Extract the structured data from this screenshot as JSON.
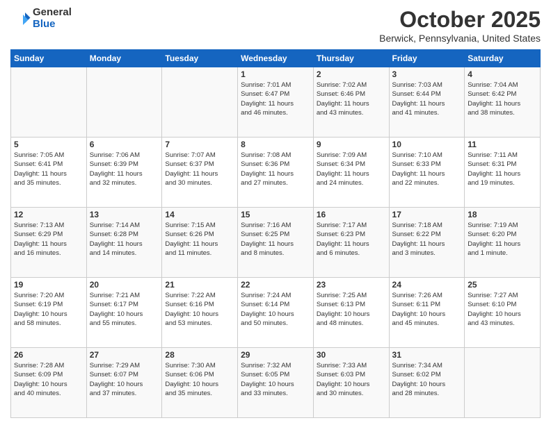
{
  "header": {
    "logo_general": "General",
    "logo_blue": "Blue",
    "month_title": "October 2025",
    "location": "Berwick, Pennsylvania, United States"
  },
  "days_of_week": [
    "Sunday",
    "Monday",
    "Tuesday",
    "Wednesday",
    "Thursday",
    "Friday",
    "Saturday"
  ],
  "weeks": [
    [
      {
        "day": "",
        "info": ""
      },
      {
        "day": "",
        "info": ""
      },
      {
        "day": "",
        "info": ""
      },
      {
        "day": "1",
        "info": "Sunrise: 7:01 AM\nSunset: 6:47 PM\nDaylight: 11 hours\nand 46 minutes."
      },
      {
        "day": "2",
        "info": "Sunrise: 7:02 AM\nSunset: 6:46 PM\nDaylight: 11 hours\nand 43 minutes."
      },
      {
        "day": "3",
        "info": "Sunrise: 7:03 AM\nSunset: 6:44 PM\nDaylight: 11 hours\nand 41 minutes."
      },
      {
        "day": "4",
        "info": "Sunrise: 7:04 AM\nSunset: 6:42 PM\nDaylight: 11 hours\nand 38 minutes."
      }
    ],
    [
      {
        "day": "5",
        "info": "Sunrise: 7:05 AM\nSunset: 6:41 PM\nDaylight: 11 hours\nand 35 minutes."
      },
      {
        "day": "6",
        "info": "Sunrise: 7:06 AM\nSunset: 6:39 PM\nDaylight: 11 hours\nand 32 minutes."
      },
      {
        "day": "7",
        "info": "Sunrise: 7:07 AM\nSunset: 6:37 PM\nDaylight: 11 hours\nand 30 minutes."
      },
      {
        "day": "8",
        "info": "Sunrise: 7:08 AM\nSunset: 6:36 PM\nDaylight: 11 hours\nand 27 minutes."
      },
      {
        "day": "9",
        "info": "Sunrise: 7:09 AM\nSunset: 6:34 PM\nDaylight: 11 hours\nand 24 minutes."
      },
      {
        "day": "10",
        "info": "Sunrise: 7:10 AM\nSunset: 6:33 PM\nDaylight: 11 hours\nand 22 minutes."
      },
      {
        "day": "11",
        "info": "Sunrise: 7:11 AM\nSunset: 6:31 PM\nDaylight: 11 hours\nand 19 minutes."
      }
    ],
    [
      {
        "day": "12",
        "info": "Sunrise: 7:13 AM\nSunset: 6:29 PM\nDaylight: 11 hours\nand 16 minutes."
      },
      {
        "day": "13",
        "info": "Sunrise: 7:14 AM\nSunset: 6:28 PM\nDaylight: 11 hours\nand 14 minutes."
      },
      {
        "day": "14",
        "info": "Sunrise: 7:15 AM\nSunset: 6:26 PM\nDaylight: 11 hours\nand 11 minutes."
      },
      {
        "day": "15",
        "info": "Sunrise: 7:16 AM\nSunset: 6:25 PM\nDaylight: 11 hours\nand 8 minutes."
      },
      {
        "day": "16",
        "info": "Sunrise: 7:17 AM\nSunset: 6:23 PM\nDaylight: 11 hours\nand 6 minutes."
      },
      {
        "day": "17",
        "info": "Sunrise: 7:18 AM\nSunset: 6:22 PM\nDaylight: 11 hours\nand 3 minutes."
      },
      {
        "day": "18",
        "info": "Sunrise: 7:19 AM\nSunset: 6:20 PM\nDaylight: 11 hours\nand 1 minute."
      }
    ],
    [
      {
        "day": "19",
        "info": "Sunrise: 7:20 AM\nSunset: 6:19 PM\nDaylight: 10 hours\nand 58 minutes."
      },
      {
        "day": "20",
        "info": "Sunrise: 7:21 AM\nSunset: 6:17 PM\nDaylight: 10 hours\nand 55 minutes."
      },
      {
        "day": "21",
        "info": "Sunrise: 7:22 AM\nSunset: 6:16 PM\nDaylight: 10 hours\nand 53 minutes."
      },
      {
        "day": "22",
        "info": "Sunrise: 7:24 AM\nSunset: 6:14 PM\nDaylight: 10 hours\nand 50 minutes."
      },
      {
        "day": "23",
        "info": "Sunrise: 7:25 AM\nSunset: 6:13 PM\nDaylight: 10 hours\nand 48 minutes."
      },
      {
        "day": "24",
        "info": "Sunrise: 7:26 AM\nSunset: 6:11 PM\nDaylight: 10 hours\nand 45 minutes."
      },
      {
        "day": "25",
        "info": "Sunrise: 7:27 AM\nSunset: 6:10 PM\nDaylight: 10 hours\nand 43 minutes."
      }
    ],
    [
      {
        "day": "26",
        "info": "Sunrise: 7:28 AM\nSunset: 6:09 PM\nDaylight: 10 hours\nand 40 minutes."
      },
      {
        "day": "27",
        "info": "Sunrise: 7:29 AM\nSunset: 6:07 PM\nDaylight: 10 hours\nand 37 minutes."
      },
      {
        "day": "28",
        "info": "Sunrise: 7:30 AM\nSunset: 6:06 PM\nDaylight: 10 hours\nand 35 minutes."
      },
      {
        "day": "29",
        "info": "Sunrise: 7:32 AM\nSunset: 6:05 PM\nDaylight: 10 hours\nand 33 minutes."
      },
      {
        "day": "30",
        "info": "Sunrise: 7:33 AM\nSunset: 6:03 PM\nDaylight: 10 hours\nand 30 minutes."
      },
      {
        "day": "31",
        "info": "Sunrise: 7:34 AM\nSunset: 6:02 PM\nDaylight: 10 hours\nand 28 minutes."
      },
      {
        "day": "",
        "info": ""
      }
    ]
  ]
}
